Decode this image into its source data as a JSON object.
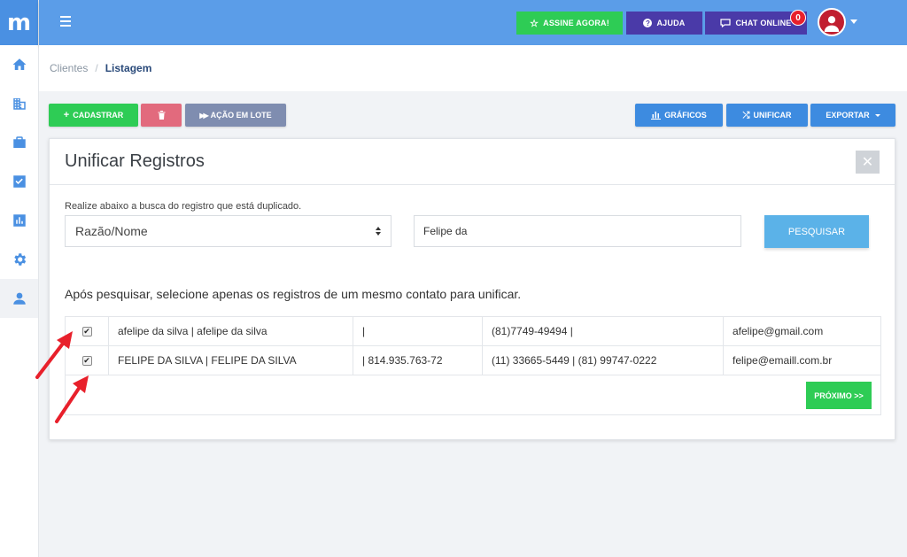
{
  "sidebar": {
    "logo": "m",
    "items": [
      {
        "icon": "home-icon"
      },
      {
        "icon": "building-icon"
      },
      {
        "icon": "briefcase-icon"
      },
      {
        "icon": "shield-check-icon"
      },
      {
        "icon": "chart-icon"
      },
      {
        "icon": "gear-icon"
      },
      {
        "icon": "user-icon"
      }
    ]
  },
  "topbar": {
    "assine_label": "ASSINE AGORA!",
    "ajuda_label": "AJUDA",
    "chat_label": "CHAT ONLINE",
    "notification_count": "0",
    "colors": {
      "bar": "#5b9de8",
      "green": "#2ecc55",
      "purple": "#4a3aa8",
      "badge": "#e8202b",
      "avatar": "#c11f30"
    }
  },
  "breadcrumb": {
    "parent": "Clientes",
    "separator": "/",
    "current": "Listagem"
  },
  "actions": {
    "cadastrar": "CADASTRAR",
    "lote": "AÇÃO EM LOTE",
    "graficos": "GRÁFICOS",
    "unificar": "UNIFICAR",
    "exportar": "EXPORTAR"
  },
  "panel": {
    "title": "Unificar Registros",
    "close": "✕",
    "hint": "Realize abaixo a busca do registro que está duplicado.",
    "select_value": "Razão/Nome",
    "search_value": "Felipe da",
    "search_button": "PESQUISAR",
    "instruction": "Após pesquisar, selecione apenas os registros de um mesmo contato para unificar.",
    "next_button": "PRÓXIMO >>"
  },
  "records": [
    {
      "checked": true,
      "name": "afelipe da silva | afelipe da silva",
      "doc": "|",
      "phone": "(81)7749-49494 |",
      "email": "afelipe@gmail.com"
    },
    {
      "checked": true,
      "name": "FELIPE DA SILVA | FELIPE DA SILVA",
      "doc": "| 814.935.763-72",
      "phone": "(11) 33665-5449 | (81) 99747-0222",
      "email": "felipe@emaill.com.br"
    }
  ]
}
